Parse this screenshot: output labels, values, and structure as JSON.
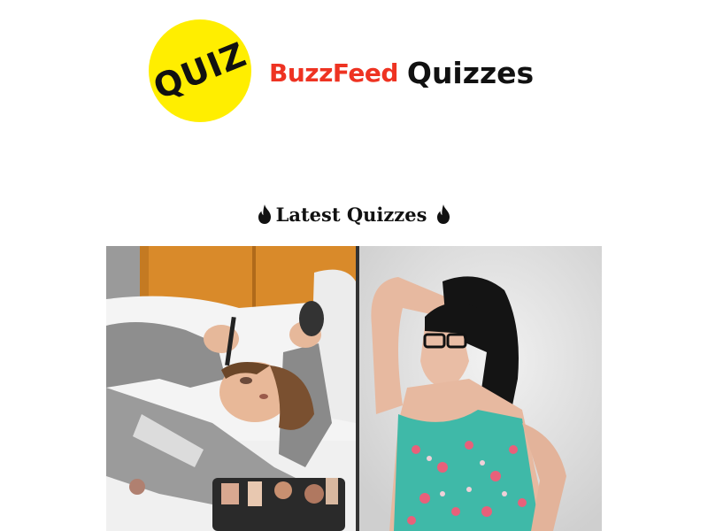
{
  "header": {
    "badge_text": "QUIZ",
    "brand_name": "BuzzFeed",
    "section_name": "Quizzes",
    "colors": {
      "badge": "#ffee00",
      "brand": "#ee3322",
      "text": "#111111"
    }
  },
  "latest": {
    "heading": "Latest Quizzes",
    "icon": "flame-icon"
  }
}
